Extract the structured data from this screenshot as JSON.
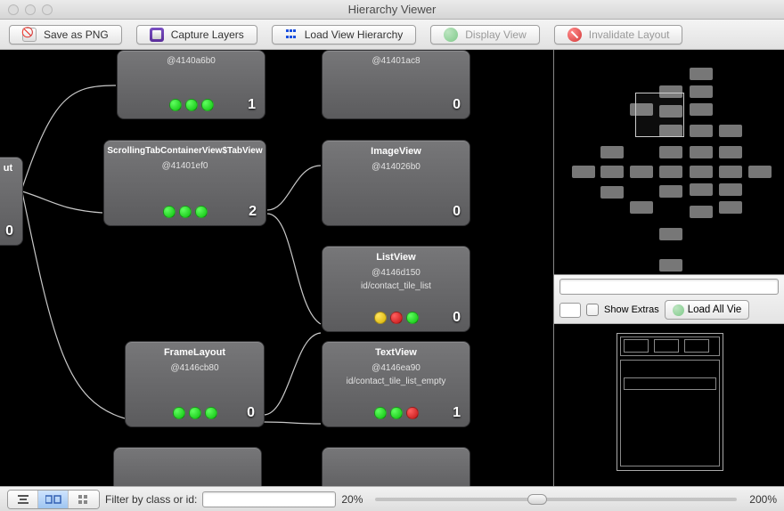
{
  "window": {
    "title": "Hierarchy Viewer"
  },
  "toolbar": {
    "save_png": "Save as PNG",
    "capture_layers": "Capture Layers",
    "load_hierarchy": "Load View Hierarchy",
    "display_view": "Display View",
    "invalidate_layout": "Invalidate Layout"
  },
  "nodes": {
    "n0": {
      "title": "ut",
      "addr": "",
      "count": "0"
    },
    "n1": {
      "title": "",
      "addr": "@4140a6b0",
      "count": "1",
      "dots": [
        "g",
        "g",
        "g"
      ]
    },
    "n2": {
      "title": "",
      "addr": "@41401ac8",
      "count": "0",
      "dots": [
        "e",
        "e",
        "e"
      ]
    },
    "n3": {
      "title": "ScrollingTabContainerView$TabView",
      "addr": "@41401ef0",
      "count": "2",
      "dots": [
        "g",
        "g",
        "g"
      ]
    },
    "n4": {
      "title": "ImageView",
      "addr": "@414026b0",
      "count": "0",
      "dots": [
        "e",
        "e",
        "e"
      ]
    },
    "n5": {
      "title": "ListView",
      "addr": "@4146d150",
      "id": "id/contact_tile_list",
      "count": "0",
      "dots": [
        "y",
        "r",
        "g"
      ]
    },
    "n6": {
      "title": "FrameLayout",
      "addr": "@4146cb80",
      "count": "0",
      "dots": [
        "g",
        "g",
        "g"
      ]
    },
    "n7": {
      "title": "TextView",
      "addr": "@4146ea90",
      "id": "id/contact_tile_list_empty",
      "count": "1",
      "dots": [
        "g",
        "g",
        "r"
      ]
    }
  },
  "sidepanel": {
    "show_extras": "Show Extras",
    "load_all_views": "Load All Vie"
  },
  "statusbar": {
    "filter_label": "Filter by class or id:",
    "zoom_min": "20%",
    "zoom_max": "200%"
  }
}
